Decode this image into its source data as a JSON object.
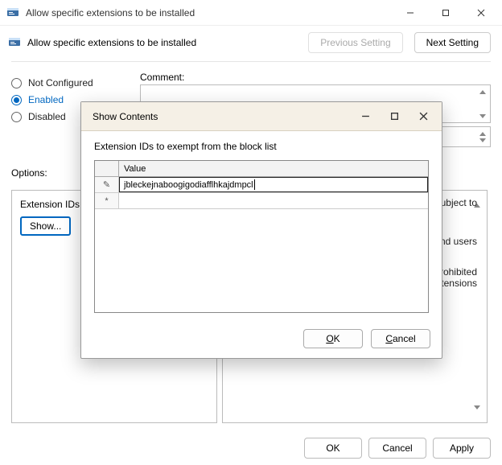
{
  "window": {
    "title": "Allow specific extensions to be installed"
  },
  "header": {
    "policy_title": "Allow specific extensions to be installed",
    "previous": "Previous Setting",
    "next": "Next Setting"
  },
  "state": {
    "not_configured": "Not Configured",
    "enabled": "Enabled",
    "disabled": "Disabled",
    "selected": "Enabled"
  },
  "comment": {
    "label": "Comment:",
    "value": ""
  },
  "options": {
    "heading": "Options:",
    "sub_label": "Extension IDs to ex",
    "show_button": "Show..."
  },
  "help": {
    "line1": "subject to",
    "line2": "and users",
    "line3": "prohibited",
    "line4": "extensions"
  },
  "footer": {
    "ok": "OK",
    "cancel": "Cancel",
    "apply": "Apply"
  },
  "modal": {
    "title": "Show Contents",
    "instruction": "Extension IDs to exempt from the block list",
    "column_header": "Value",
    "row_edit_indicator": "✎",
    "row_new_indicator": "*",
    "value1": "jbleckejnaboogigodiafflhkajdmpcl",
    "ok_prefix": "O",
    "ok_suffix": "K",
    "cancel_prefix": "C",
    "cancel_suffix": "ancel"
  }
}
